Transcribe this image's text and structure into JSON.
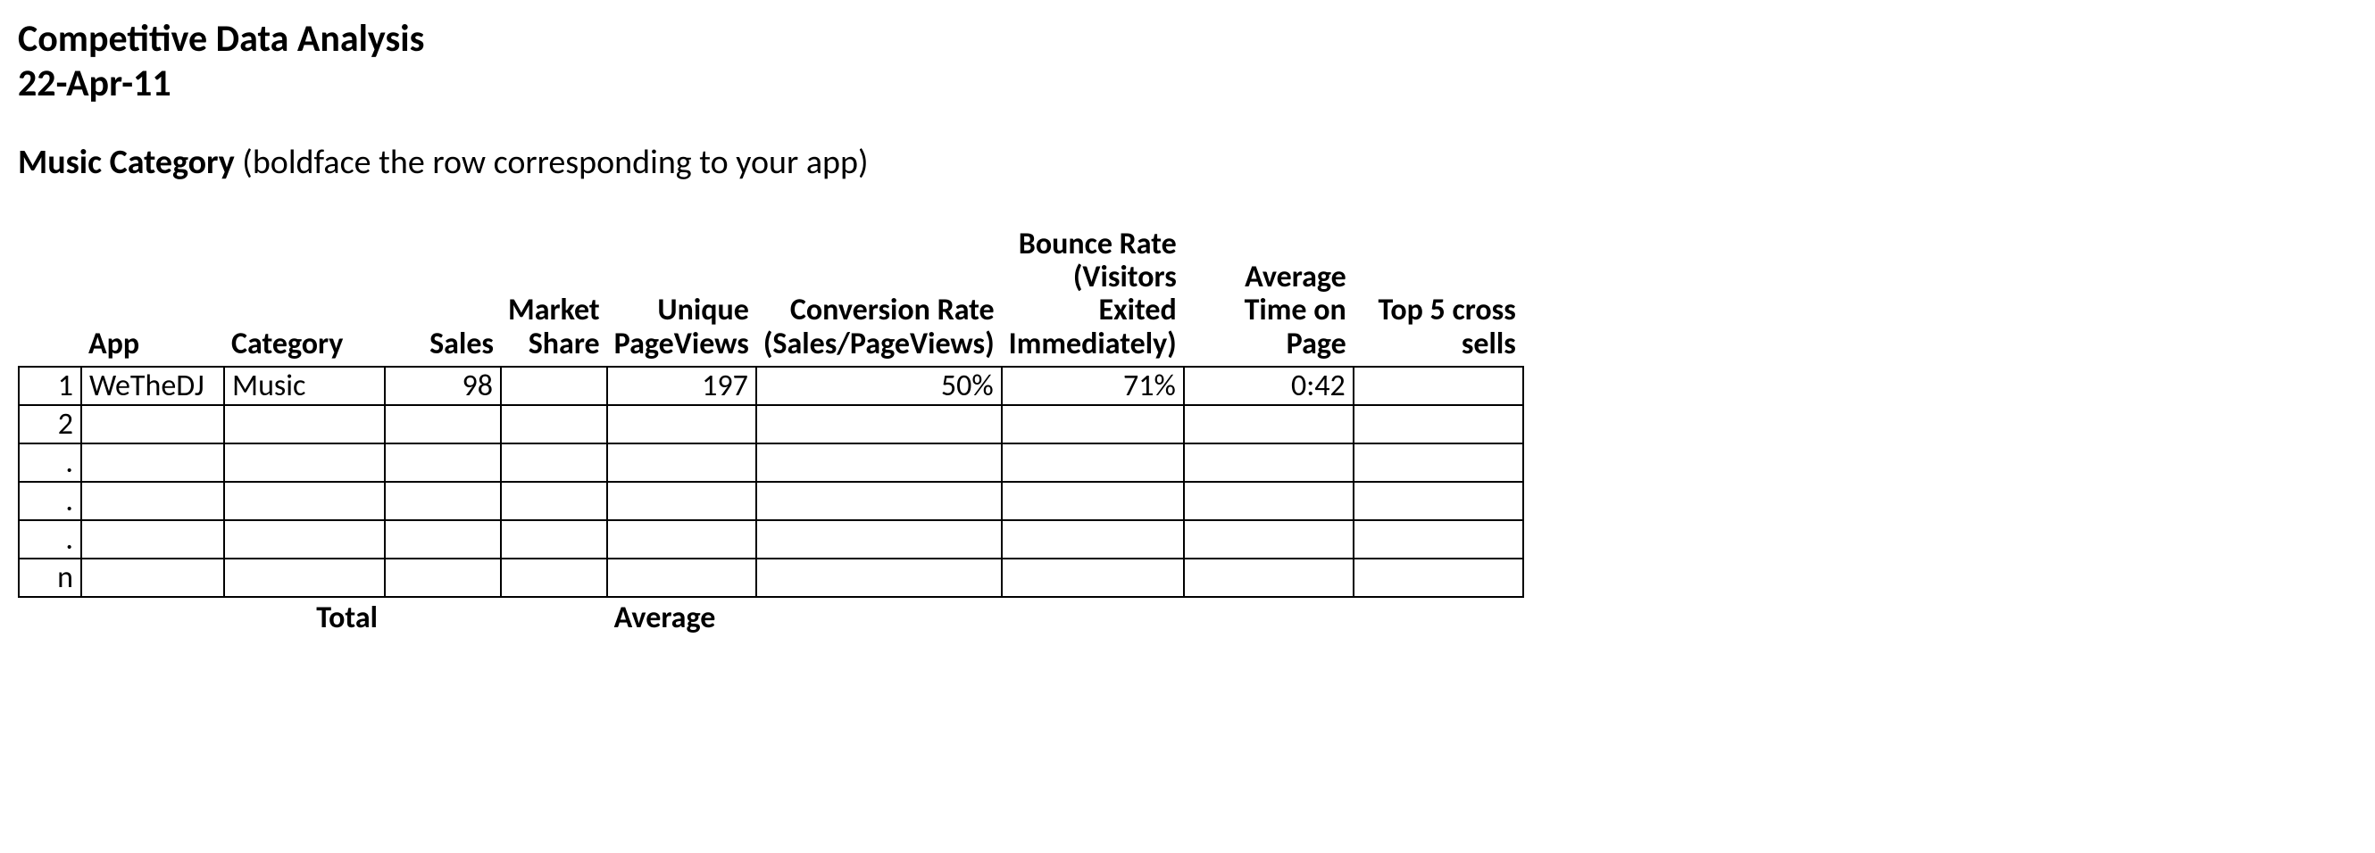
{
  "header": {
    "title": "Competitive Data Analysis",
    "date": "22-Apr-11"
  },
  "subtitle": {
    "bold": "Music Category",
    "note": " (boldface the row corresponding to your app)"
  },
  "table": {
    "columns": {
      "idx": "",
      "app": "App",
      "category": "Category",
      "sales": "Sales",
      "share": "Market Share",
      "pv": "Unique PageViews",
      "conv": "Conversion Rate (Sales/PageViews)",
      "bounce": "Bounce Rate (Visitors Exited Immediately)",
      "time": "Average Time on Page",
      "cross": "Top 5 cross sells"
    },
    "rows": [
      {
        "idx": "1",
        "app": "WeTheDJ",
        "category": "Music",
        "sales": "98",
        "share": "",
        "pv": "197",
        "conv": "50%",
        "bounce": "71%",
        "time": "0:42",
        "cross": ""
      },
      {
        "idx": "2",
        "app": "",
        "category": "",
        "sales": "",
        "share": "",
        "pv": "",
        "conv": "",
        "bounce": "",
        "time": "",
        "cross": ""
      },
      {
        "idx": ".",
        "app": "",
        "category": "",
        "sales": "",
        "share": "",
        "pv": "",
        "conv": "",
        "bounce": "",
        "time": "",
        "cross": ""
      },
      {
        "idx": ".",
        "app": "",
        "category": "",
        "sales": "",
        "share": "",
        "pv": "",
        "conv": "",
        "bounce": "",
        "time": "",
        "cross": ""
      },
      {
        "idx": ".",
        "app": "",
        "category": "",
        "sales": "",
        "share": "",
        "pv": "",
        "conv": "",
        "bounce": "",
        "time": "",
        "cross": ""
      },
      {
        "idx": "n",
        "app": "",
        "category": "",
        "sales": "",
        "share": "",
        "pv": "",
        "conv": "",
        "bounce": "",
        "time": "",
        "cross": ""
      }
    ],
    "footer": {
      "totalLabel": "Total",
      "averageLabel": "Average"
    }
  }
}
